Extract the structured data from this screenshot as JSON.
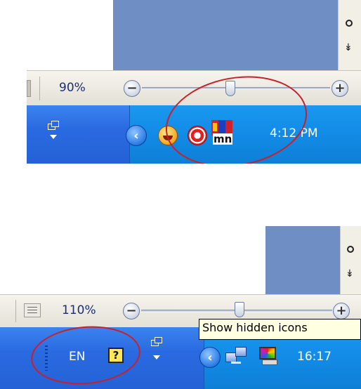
{
  "top": {
    "zoom_label": "90%",
    "zoom_out": "−",
    "zoom_in": "+",
    "clock": "4:12 PM",
    "tray_icons": [
      "emoticon-icon",
      "target-icon",
      "language-mn-icon"
    ],
    "lang_text": "mn"
  },
  "bottom": {
    "zoom_label": "110%",
    "zoom_out": "−",
    "zoom_in": "+",
    "clock": "16:17",
    "lang": "EN",
    "help": "?",
    "tooltip": "Show hidden icons"
  },
  "colors": {
    "taskbar": "#2a6ae0",
    "tray": "#128be6",
    "annotation": "#c8202a",
    "tooltip_bg": "#ffffe1"
  }
}
